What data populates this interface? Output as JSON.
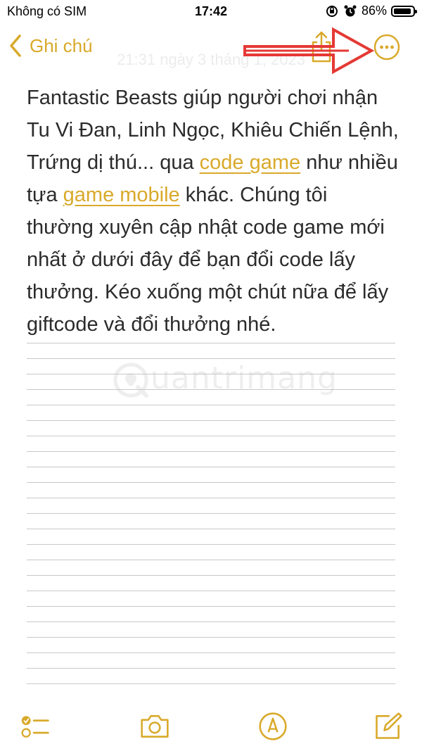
{
  "status_bar": {
    "carrier": "Không có SIM",
    "time": "17:42",
    "battery_percent": "86%"
  },
  "nav": {
    "back_label": "Ghi chú"
  },
  "note": {
    "date": "21:31 ngày 3 tháng 1, 2023",
    "segments": [
      {
        "type": "text",
        "value": "Fantastic Beasts giúp người chơi nhận Tu Vi Đan, Linh Ngọc, Khiêu Chiến Lệnh, Trứng dị thú... qua "
      },
      {
        "type": "link",
        "value": "code game"
      },
      {
        "type": "text",
        "value": " như nhiều tựa "
      },
      {
        "type": "link",
        "value": "game mobile"
      },
      {
        "type": "text",
        "value": " khác. Chúng tôi thường xuyên cập nhật code game mới nhất ở dưới đây để bạn đổi code lấy thưởng. Kéo xuống một chút nữa để lấy giftcode và đổi thưởng nhé."
      }
    ]
  },
  "watermark": {
    "text": "uantrimang"
  },
  "colors": {
    "accent": "#D9A92A",
    "arrow": "#E53935",
    "text": "#2b2b2b"
  },
  "icons": [
    "back-chevron-icon",
    "share-icon",
    "more-ellipsis-icon",
    "checklist-icon",
    "camera-icon",
    "markup-pen-icon",
    "compose-icon"
  ]
}
